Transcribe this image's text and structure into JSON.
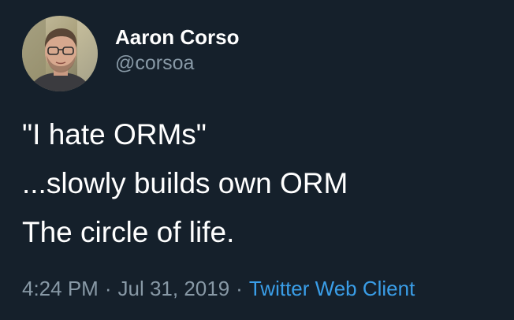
{
  "author": {
    "display_name": "Aaron Corso",
    "handle": "@corsoa",
    "avatar_icon": "user-avatar"
  },
  "tweet": {
    "lines": [
      "\"I hate ORMs\"",
      "...slowly builds own ORM",
      "The circle of life."
    ]
  },
  "meta": {
    "time": "4:24 PM",
    "separator": "·",
    "date": "Jul 31, 2019",
    "client": "Twitter Web Client"
  },
  "colors": {
    "background": "#15202b",
    "text_primary": "#ffffff",
    "text_secondary": "#8899a6",
    "link": "#3a9ee8"
  }
}
